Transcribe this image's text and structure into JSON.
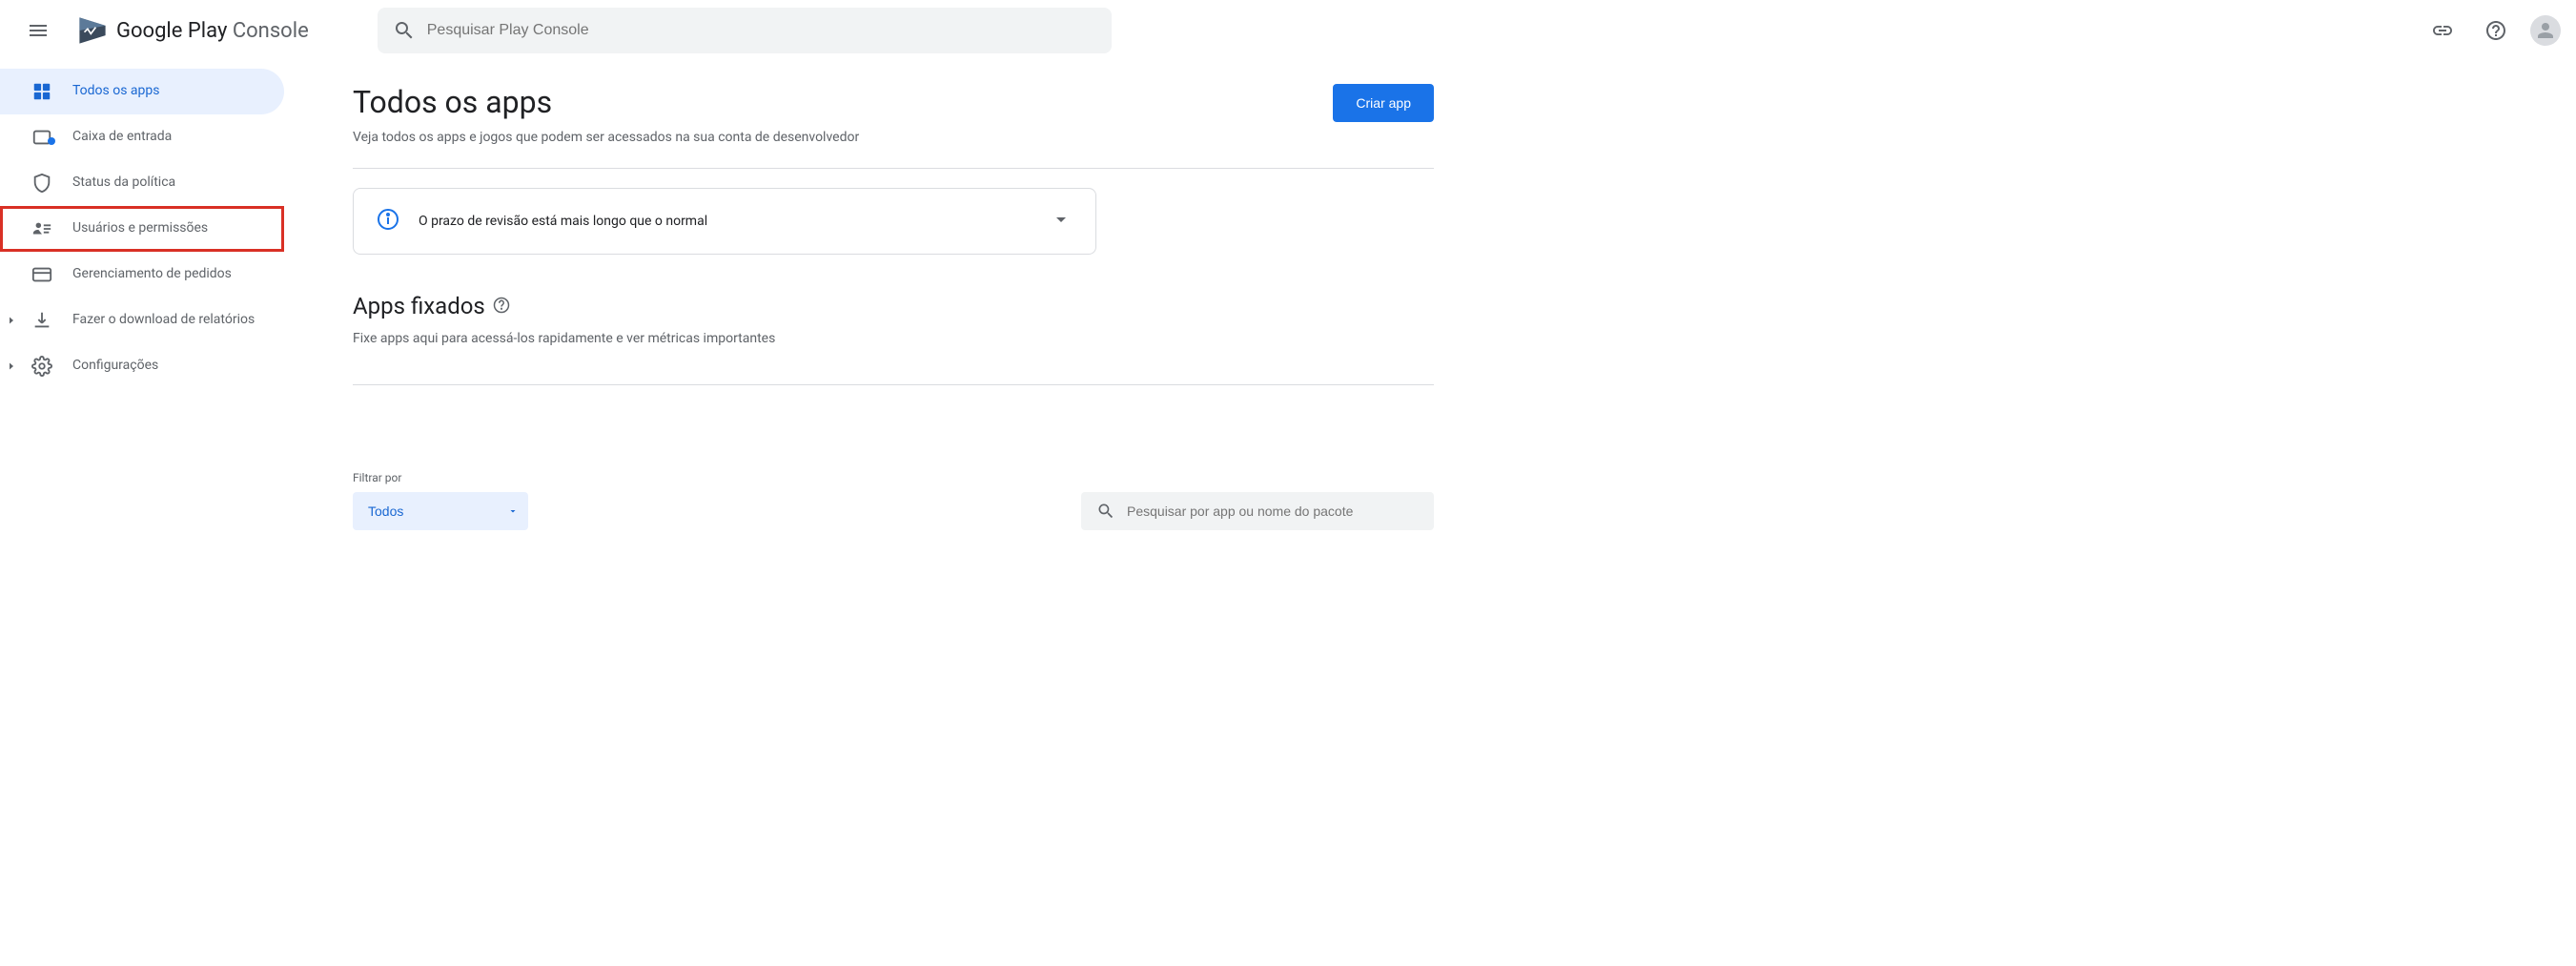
{
  "header": {
    "logo_play": "Google Play",
    "logo_console": " Console",
    "search_placeholder": "Pesquisar Play Console"
  },
  "sidebar": {
    "items": [
      {
        "label": "Todos os apps"
      },
      {
        "label": "Caixa de entrada"
      },
      {
        "label": "Status da política"
      },
      {
        "label": "Usuários e permissões"
      },
      {
        "label": "Gerenciamento de pedidos"
      },
      {
        "label": "Fazer o download de relatórios"
      },
      {
        "label": "Configurações"
      }
    ]
  },
  "main": {
    "title": "Todos os apps",
    "subtitle": "Veja todos os apps e jogos que podem ser acessados na sua conta de desenvolvedor",
    "create_button": "Criar app",
    "notice": "O prazo de revisão está mais longo que o normal",
    "pinned_title": "Apps fixados",
    "pinned_subtitle": "Fixe apps aqui para acessá-los rapidamente e ver métricas importantes",
    "filter_label": "Filtrar por",
    "filter_value": "Todos",
    "search_apps_placeholder": "Pesquisar por app ou nome do pacote"
  },
  "colors": {
    "primary": "#1a73e8",
    "highlight": "#d93025"
  }
}
